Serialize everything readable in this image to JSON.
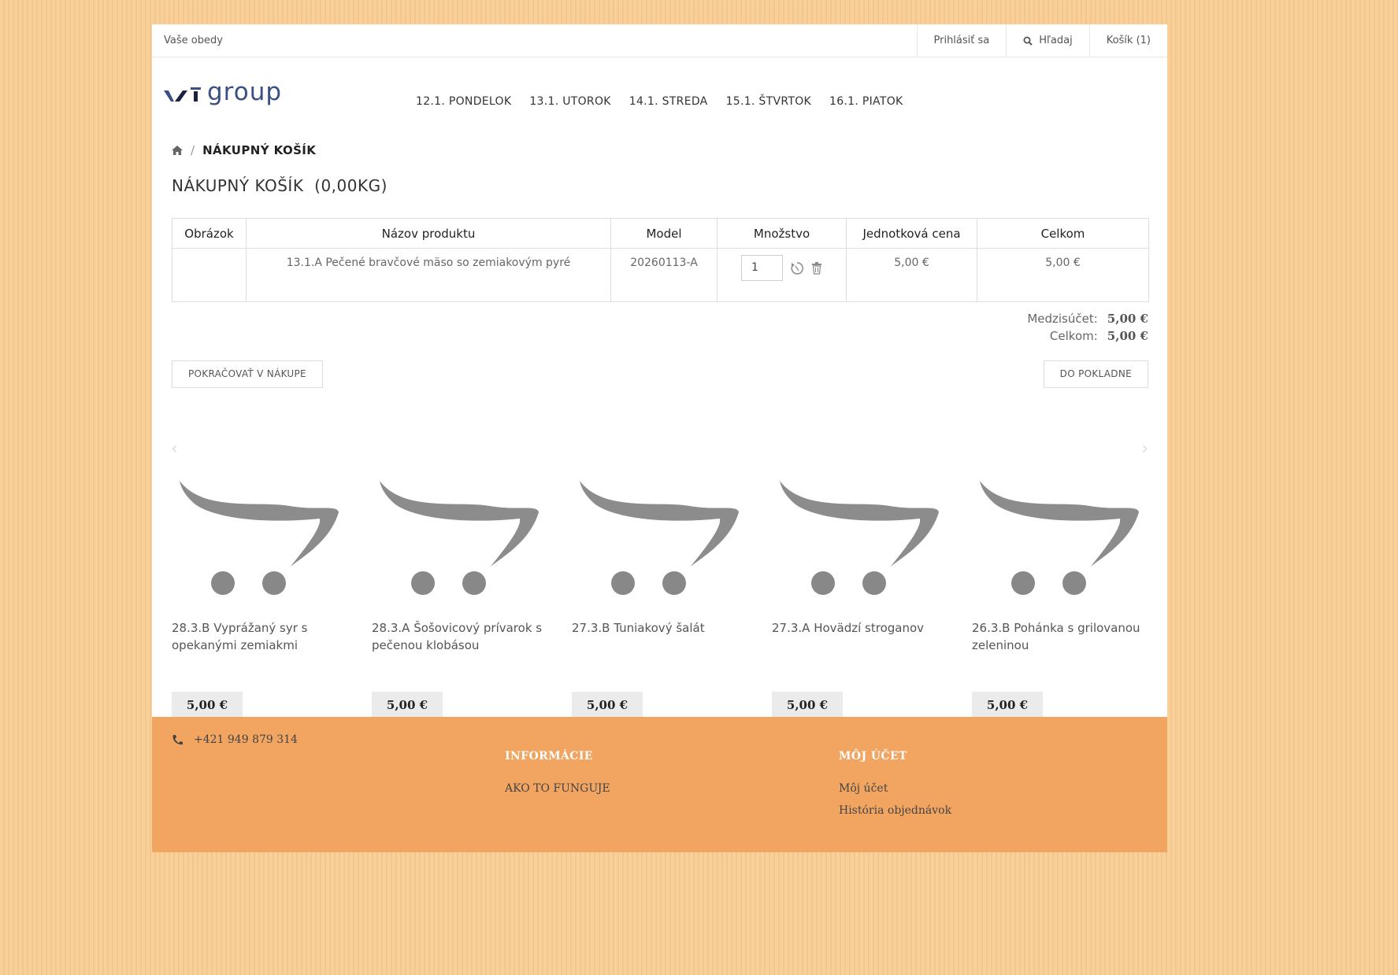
{
  "topbar": {
    "brand": "Vaše obedy",
    "login": "Prihlásiť sa",
    "search": "Hľadaj",
    "cart": "Košík (1)"
  },
  "logo": {
    "text": "group",
    "color": "#3a4f82"
  },
  "days": [
    "12.1. PONDELOK",
    "13.1. UTOROK",
    "14.1. STREDA",
    "15.1. ŠTVRTOK",
    "16.1. PIATOK"
  ],
  "breadcrumb": {
    "current": "NÁKUPNÝ KOŠÍK",
    "separator": "/"
  },
  "page_title": "NÁKUPNÝ KOŠÍK  (0,00KG)",
  "cart_table": {
    "headers": [
      "Obrázok",
      "Názov produktu",
      "Model",
      "Množstvo",
      "Jednotková cena",
      "Celkom"
    ],
    "rows": [
      {
        "image": "",
        "name": "13.1.A Pečené bravčové mäso so zemiakovým pyré",
        "model": "20260113-A",
        "quantity": "1",
        "unit_price": "5,00 €",
        "total": "5,00 €"
      }
    ]
  },
  "totals": {
    "subtotal_label": "Medzisúčet:",
    "subtotal": "5,00 €",
    "total_label": "Celkom:",
    "total": "5,00 €"
  },
  "buttons": {
    "continue": "POKRAČOVAŤ V NÁKUPE",
    "checkout": "DO POKLADNE"
  },
  "products": [
    {
      "name": "28.3.B Vyprážaný syr s opekanými zemiakmi",
      "price": "5,00 €"
    },
    {
      "name": "28.3.A Šošovicový prívarok s pečenou klobásou",
      "price": "5,00 €"
    },
    {
      "name": "27.3.B Tuniakový šalát",
      "price": "5,00 €"
    },
    {
      "name": "27.3.A Hovädzí stroganov",
      "price": "5,00 €"
    },
    {
      "name": "26.3.B Pohánka s grilovanou zeleninou",
      "price": "5,00 €"
    }
  ],
  "footer": {
    "phone": "+421 949 879 314",
    "info_heading": "INFORMÁCIE",
    "info_link": "AKO TO FUNGUJE",
    "account_heading": "MÔJ ÚČET",
    "account_link": "Môj účet",
    "history_link": "História objednávok"
  },
  "colors": {
    "footer_bg": "#f2a461",
    "page_bg": "#f9d09a"
  }
}
